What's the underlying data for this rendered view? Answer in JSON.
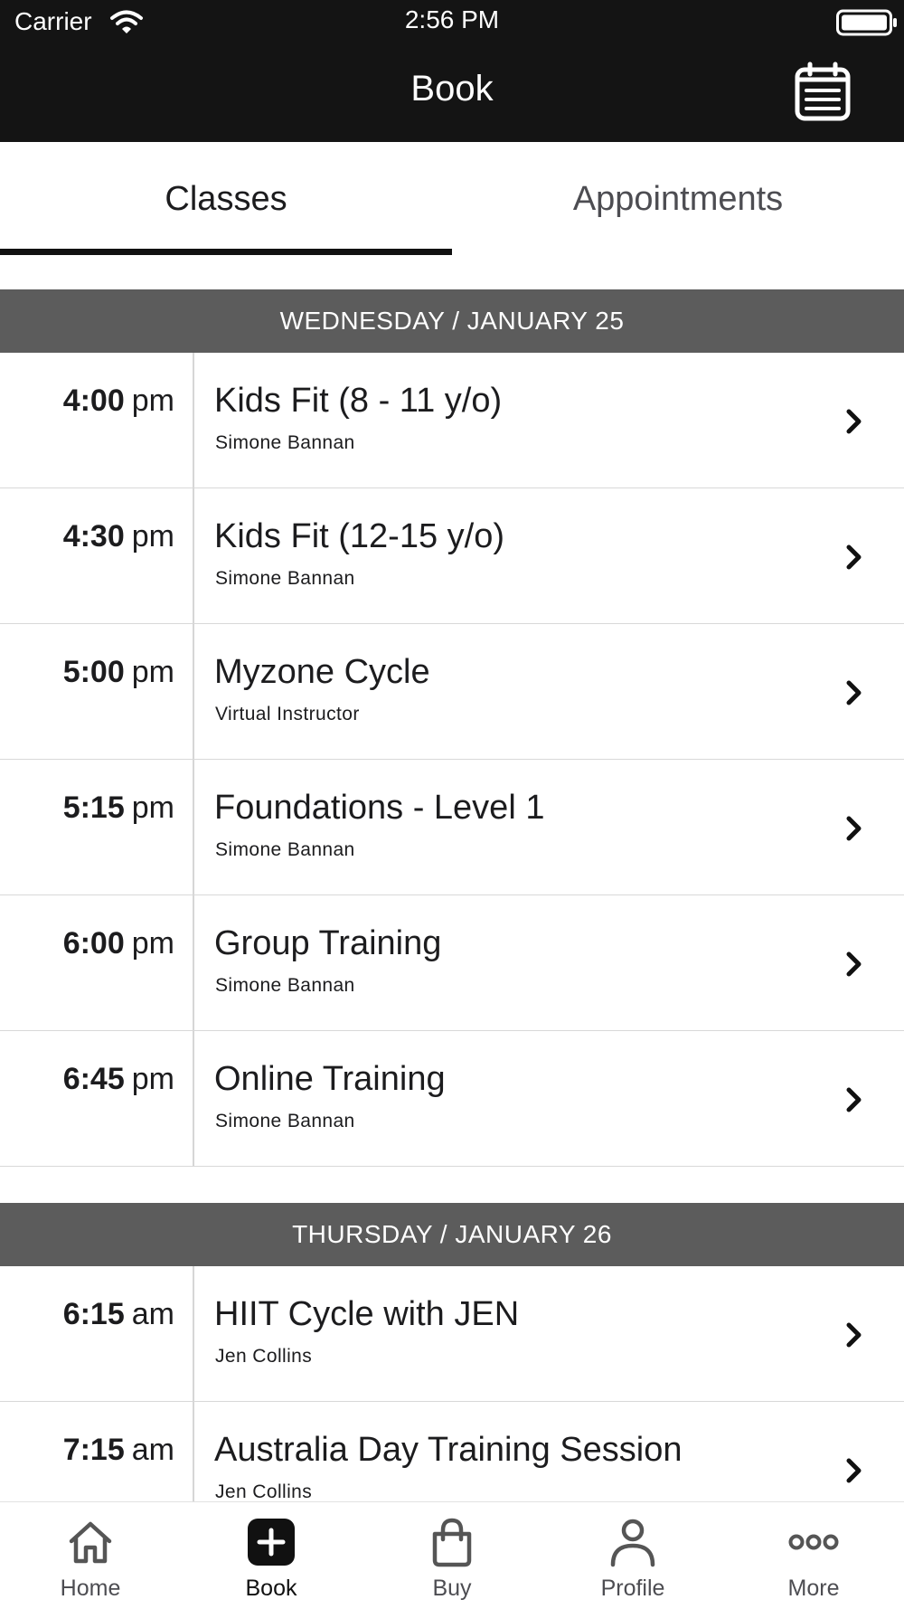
{
  "status_bar": {
    "carrier": "Carrier",
    "time": "2:56 PM",
    "icons": [
      "wifi-icon",
      "battery-icon"
    ]
  },
  "header": {
    "title": "Book",
    "icon": "calendar-list-icon"
  },
  "tabs": [
    {
      "label": "Classes",
      "active": true
    },
    {
      "label": "Appointments",
      "active": false
    }
  ],
  "sections": [
    {
      "heading": "WEDNESDAY / JANUARY 25",
      "classes": [
        {
          "time": "4:00",
          "ampm": "pm",
          "title": "Kids Fit (8 - 11 y/o)",
          "instructor": "Simone Bannan"
        },
        {
          "time": "4:30",
          "ampm": "pm",
          "title": "Kids Fit (12-15 y/o)",
          "instructor": "Simone Bannan"
        },
        {
          "time": "5:00",
          "ampm": "pm",
          "title": "Myzone Cycle",
          "instructor": "Virtual Instructor"
        },
        {
          "time": "5:15",
          "ampm": "pm",
          "title": "Foundations - Level 1",
          "instructor": "Simone Bannan"
        },
        {
          "time": "6:00",
          "ampm": "pm",
          "title": "Group Training",
          "instructor": "Simone Bannan"
        },
        {
          "time": "6:45",
          "ampm": "pm",
          "title": "Online Training",
          "instructor": "Simone Bannan"
        }
      ]
    },
    {
      "heading": "THURSDAY / JANUARY 26",
      "classes": [
        {
          "time": "6:15",
          "ampm": "am",
          "title": "HIIT Cycle with JEN",
          "instructor": "Jen Collins"
        },
        {
          "time": "7:15",
          "ampm": "am",
          "title": "Australia Day Training Session",
          "instructor": "Jen Collins"
        }
      ]
    }
  ],
  "tab_bar": [
    {
      "label": "Home",
      "icon": "home-icon",
      "active": false
    },
    {
      "label": "Book",
      "icon": "plus-square-icon",
      "active": true
    },
    {
      "label": "Buy",
      "icon": "shopping-bag-icon",
      "active": false
    },
    {
      "label": "Profile",
      "icon": "person-icon",
      "active": false
    },
    {
      "label": "More",
      "icon": "more-dots-icon",
      "active": false
    }
  ],
  "colors": {
    "header_bg": "#141414",
    "section_header_bg": "#5c5c5c",
    "tab_underline": "#111111",
    "divider": "#d8d8d8"
  }
}
